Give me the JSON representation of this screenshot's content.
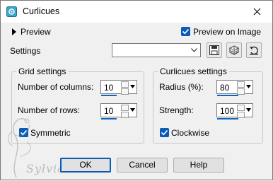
{
  "window": {
    "title": "Curlicues"
  },
  "preview": {
    "toggle_label": "Preview",
    "preview_on_image_label": "Preview on Image",
    "preview_on_image_checked": true
  },
  "settings": {
    "label": "Settings",
    "preset_value": ""
  },
  "toolbar": {
    "save_icon": "save-preset-icon",
    "randomize_icon": "randomize-icon",
    "reset_icon": "reset-icon"
  },
  "grid": {
    "title": "Grid settings",
    "columns_label": "Number of columns:",
    "columns_value": "10",
    "rows_label": "Number of rows:",
    "rows_value": "10",
    "symmetric_label": "Symmetric",
    "symmetric_checked": true
  },
  "curlicues": {
    "title": "Curlicues settings",
    "radius_label": "Radius (%):",
    "radius_value": "80",
    "strength_label": "Strength:",
    "strength_value": "100",
    "clockwise_label": "Clockwise",
    "clockwise_checked": true
  },
  "buttons": {
    "ok": "OK",
    "cancel": "Cancel",
    "help": "Help"
  },
  "watermark": {
    "text": "Sylviane"
  },
  "colors": {
    "accent": "#0a5cb8",
    "background": "#f0f0f0"
  }
}
